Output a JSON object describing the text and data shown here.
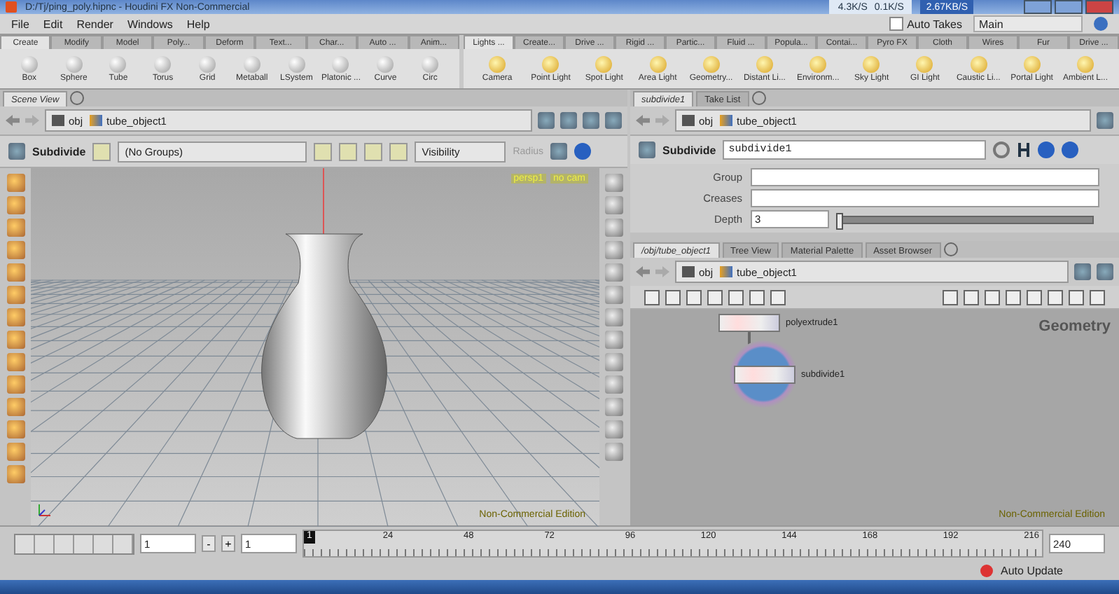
{
  "title_bar": {
    "title": "D:/Tj/ping_poly.hipnc - Houdini FX Non-Commercial"
  },
  "net_speed": {
    "down": "4.3K/S",
    "up": "0.1K/S",
    "rate": "2.67KB/S"
  },
  "menu": [
    "File",
    "Edit",
    "Render",
    "Windows",
    "Help"
  ],
  "auto_takes": {
    "label": "Auto Takes",
    "checked": false
  },
  "take": "Main",
  "shelves": [
    {
      "tabs": [
        {
          "label": "Create",
          "selected": true
        },
        {
          "label": "Modify",
          "selected": false
        },
        {
          "label": "Model",
          "selected": false
        },
        {
          "label": "Poly...",
          "selected": false
        },
        {
          "label": "Deform",
          "selected": false
        },
        {
          "label": "Text...",
          "selected": false
        },
        {
          "label": "Char...",
          "selected": false
        },
        {
          "label": "Auto ...",
          "selected": false
        },
        {
          "label": "Anim...",
          "selected": false
        }
      ],
      "tools": [
        "Box",
        "Sphere",
        "Tube",
        "Torus",
        "Grid",
        "Metaball",
        "LSystem",
        "Platonic ...",
        "Curve",
        "Circ"
      ]
    },
    {
      "tabs": [
        {
          "label": "Lights ...",
          "selected": true
        },
        {
          "label": "Create...",
          "selected": false
        },
        {
          "label": "Drive ...",
          "selected": false
        },
        {
          "label": "Rigid ...",
          "selected": false
        },
        {
          "label": "Partic...",
          "selected": false
        },
        {
          "label": "Fluid ...",
          "selected": false
        },
        {
          "label": "Popula...",
          "selected": false
        },
        {
          "label": "Contai...",
          "selected": false
        },
        {
          "label": "Pyro FX",
          "selected": false
        },
        {
          "label": "Cloth",
          "selected": false
        },
        {
          "label": "Wires",
          "selected": false
        },
        {
          "label": "Fur",
          "selected": false
        },
        {
          "label": "Drive ...",
          "selected": false
        }
      ],
      "tools": [
        "Camera",
        "Point Light",
        "Spot Light",
        "Area Light",
        "Geometry...",
        "Distant Li...",
        "Environm...",
        "Sky Light",
        "GI Light",
        "Caustic Li...",
        "Portal Light",
        "Ambient L..."
      ]
    }
  ],
  "scene_view": {
    "tabs": [
      {
        "label": "Scene View",
        "selected": true
      }
    ],
    "path": [
      "obj",
      "tube_object1"
    ],
    "operation": "Subdivide",
    "group": "(No Groups)",
    "visibility": "Visibility",
    "radius": "Radius",
    "camera": "persp1",
    "camera_menu": "no cam",
    "edition": "Non-Commercial Edition"
  },
  "parameters": {
    "tabs": [
      {
        "label": "subdivide1",
        "selected": true
      },
      {
        "label": "Take List",
        "selected": false
      }
    ],
    "path": [
      "obj",
      "tube_object1"
    ],
    "type": "Subdivide",
    "name": "subdivide1",
    "fields": [
      {
        "label": "Group",
        "kind": "text"
      },
      {
        "label": "Creases",
        "kind": "text"
      },
      {
        "label": "Depth",
        "kind": "slider",
        "value": "3",
        "level": 0
      }
    ]
  },
  "network": {
    "tabs": [
      {
        "label": "/obj/tube_object1",
        "selected": true
      },
      {
        "label": "Tree View",
        "selected": false
      },
      {
        "label": "Material Palette",
        "selected": false
      },
      {
        "label": "Asset Browser",
        "selected": false
      }
    ],
    "path": [
      "obj",
      "tube_object1"
    ],
    "context": "Geometry",
    "nodes": [
      {
        "name": "polyextrude1",
        "selected": false
      },
      {
        "name": "subdivide1",
        "selected": true
      }
    ],
    "edition": "Non-Commercial Edition"
  },
  "timeline": {
    "start": "1",
    "step_buttons": [
      "-",
      "+"
    ],
    "step": "1",
    "current": "1",
    "ticks": [
      "24",
      "48",
      "72",
      "96",
      "120",
      "144",
      "168",
      "192",
      "216"
    ],
    "end": "240"
  },
  "status": {
    "auto_update": "Auto Update"
  }
}
